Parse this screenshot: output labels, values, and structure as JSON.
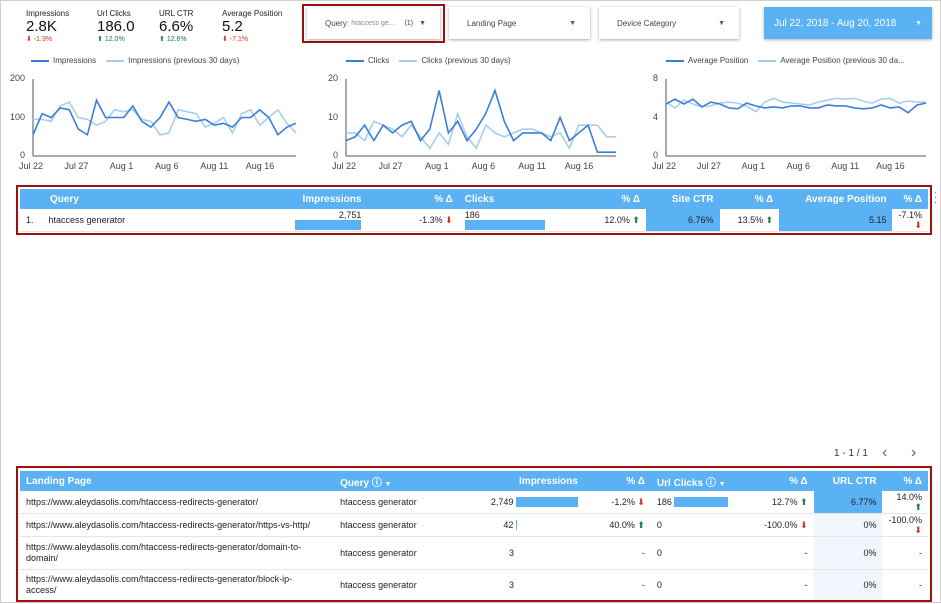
{
  "scorecards": [
    {
      "label": "Impressions",
      "value": "2.8K",
      "delta": "-1.3%",
      "dir": "down"
    },
    {
      "label": "Url Clicks",
      "value": "186.0",
      "delta": "12.0%",
      "dir": "up"
    },
    {
      "label": "URL CTR",
      "value": "6.6%",
      "delta": "12.6%",
      "dir": "up"
    },
    {
      "label": "Average Position",
      "value": "5.2",
      "delta": "-7.1%",
      "dir": "down"
    }
  ],
  "filters": {
    "query_label": "Query",
    "query_value": "htaccess ge...",
    "query_count": "(1)",
    "landing_page": "Landing Page",
    "device_category": "Device Category",
    "date_range": "Jul 22, 2018 - Aug 20, 2018"
  },
  "charts": [
    {
      "type": "line",
      "series_name": "Impressions",
      "prev_name": "Impressions (previous 30 days)",
      "yticks": [
        "200",
        "100",
        "0"
      ],
      "ylim": [
        0,
        200
      ],
      "xticks": [
        "Jul 22",
        "Jul 27",
        "Aug 1",
        "Aug 6",
        "Aug 11",
        "Aug 16"
      ],
      "current": [
        55,
        110,
        100,
        125,
        120,
        70,
        55,
        145,
        100,
        100,
        100,
        130,
        90,
        75,
        100,
        140,
        100,
        95,
        90,
        95,
        80,
        85,
        75,
        100,
        100,
        120,
        100,
        55,
        75,
        85
      ],
      "previous": [
        95,
        95,
        90,
        130,
        140,
        100,
        95,
        80,
        90,
        120,
        115,
        120,
        95,
        90,
        55,
        60,
        120,
        115,
        110,
        75,
        85,
        100,
        60,
        110,
        120,
        80,
        100,
        120,
        85,
        60
      ]
    },
    {
      "type": "line",
      "series_name": "Clicks",
      "prev_name": "Clicks (previous 30 days)",
      "yticks": [
        "20",
        "10",
        "0"
      ],
      "ylim": [
        0,
        20
      ],
      "xticks": [
        "Jul 22",
        "Jul 27",
        "Aug 1",
        "Aug 6",
        "Aug 11",
        "Aug 16"
      ],
      "current": [
        4,
        5,
        8,
        4,
        8,
        6,
        8,
        9,
        4,
        7,
        17,
        6,
        9,
        4,
        7,
        11,
        17,
        9,
        4,
        6,
        6,
        6,
        4,
        10,
        4,
        6,
        8,
        1,
        1,
        1
      ],
      "previous": [
        6,
        6,
        4,
        9,
        8,
        7,
        5,
        8,
        5,
        2,
        6,
        3,
        11,
        5,
        2,
        8,
        6,
        5,
        6,
        7,
        7,
        6,
        5,
        6,
        2,
        8,
        8,
        8,
        5,
        5
      ]
    },
    {
      "type": "line",
      "series_name": "Average Position",
      "prev_name": "Average Position (previous 30 da...",
      "yticks": [
        "8",
        "4",
        "0"
      ],
      "ylim": [
        0,
        8
      ],
      "xticks": [
        "Jul 22",
        "Jul 27",
        "Aug 1",
        "Aug 6",
        "Aug 11",
        "Aug 16"
      ],
      "current": [
        5.4,
        5.9,
        5.4,
        5.9,
        5.1,
        5.6,
        5.4,
        5.0,
        4.9,
        5.5,
        5.2,
        5.0,
        5.1,
        5.0,
        5.2,
        5.2,
        5.0,
        5.0,
        5.3,
        5.2,
        5.2,
        5.0,
        4.9,
        5.0,
        5.3,
        5.0,
        5.1,
        4.5,
        5.3,
        5.5
      ],
      "previous": [
        5.6,
        5.0,
        5.8,
        5.4,
        5.1,
        5.2,
        5.5,
        5.6,
        5.5,
        5.2,
        4.6,
        5.6,
        6.0,
        5.6,
        5.5,
        5.4,
        5.3,
        5.6,
        5.8,
        6.0,
        5.9,
        6.0,
        5.7,
        5.5,
        5.9,
        6.0,
        5.5,
        5.7,
        5.6,
        5.6
      ]
    }
  ],
  "query_table": {
    "headers": [
      "Query",
      "Impressions",
      "% Δ",
      "Clicks",
      "% Δ",
      "Site CTR",
      "% Δ",
      "Average Position",
      "% Δ"
    ],
    "rows": [
      {
        "idx": "1.",
        "query": "htaccess generator",
        "impressions": "2,751",
        "imp_delta": "-1.3%",
        "clicks": "186",
        "clicks_delta": "12.0%",
        "ctr": "6.76%",
        "ctr_delta": "13.5%",
        "pos": "5.15",
        "pos_delta": "-7.1%"
      }
    ]
  },
  "pager": {
    "text": "1 - 1 / 1",
    "prev": "‹",
    "next": "›"
  },
  "landing_table": {
    "headers": [
      "Landing Page",
      "Query",
      "Impressions",
      "% Δ",
      "Url Clicks",
      "% Δ",
      "URL CTR",
      "% Δ"
    ],
    "rows": [
      {
        "page": "https://www.aleydasolis.com/htaccess-redirects-generator/",
        "query": "htaccess generator",
        "impressions": "2,749",
        "imp_delta": "-1.2%",
        "clicks": "186",
        "clicks_delta": "12.7%",
        "ctr": "6.77%",
        "ctr_delta": "14.0%"
      },
      {
        "page": "https://www.aleydasolis.com/htaccess-redirects-generator/https-vs-http/",
        "query": "htaccess generator",
        "impressions": "42",
        "imp_delta": "40.0%",
        "clicks": "0",
        "clicks_delta": "-100.0%",
        "ctr": "0%",
        "ctr_delta": "-100.0%"
      },
      {
        "page": "https://www.aleydasolis.com/htaccess-redirects-generator/domain-to-domain/",
        "query": "htaccess generator",
        "impressions": "3",
        "imp_delta": "-",
        "clicks": "0",
        "clicks_delta": "-",
        "ctr": "0%",
        "ctr_delta": "-"
      },
      {
        "page": "https://www.aleydasolis.com/htaccess-redirects-generator/block-ip-access/",
        "query": "htaccess generator",
        "impressions": "3",
        "imp_delta": "-",
        "clicks": "0",
        "clicks_delta": "-",
        "ctr": "0%",
        "ctr_delta": "-"
      }
    ]
  },
  "colors": {
    "accent": "#5ab1f3",
    "current": "#3a7fd5",
    "previous": "#a9cdf2",
    "highlight": "#9b1111"
  }
}
